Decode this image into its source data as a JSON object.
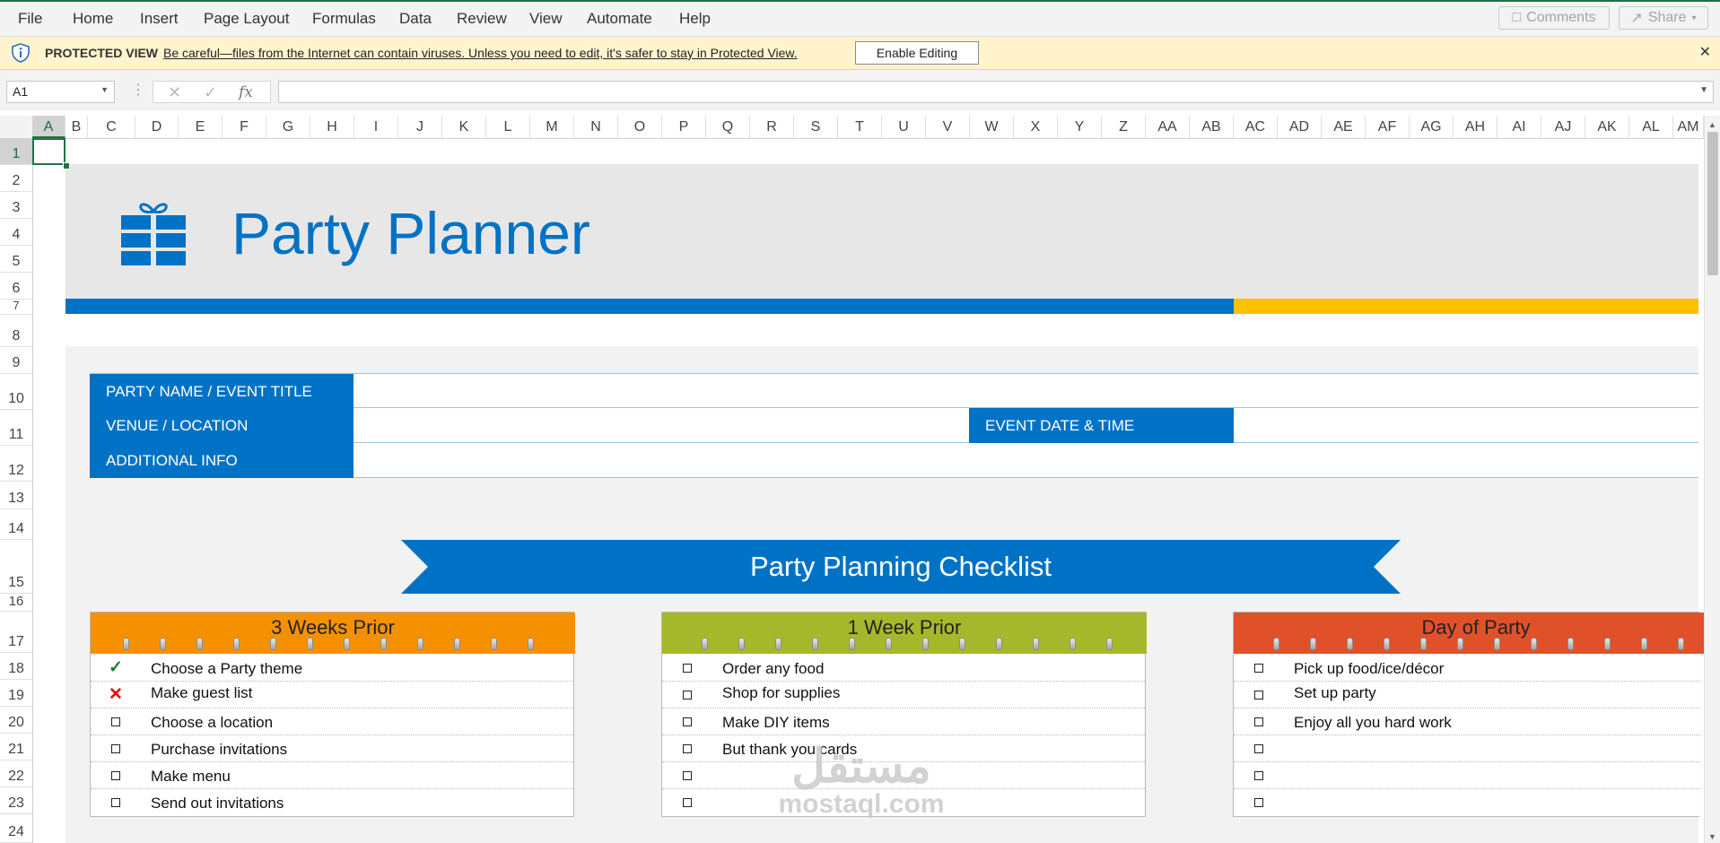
{
  "menu": {
    "items": [
      "File",
      "Home",
      "Insert",
      "Page Layout",
      "Formulas",
      "Data",
      "Review",
      "View",
      "Automate",
      "Help"
    ],
    "comments_label": "Comments",
    "share_label": "Share"
  },
  "protected_view": {
    "title": "PROTECTED VIEW",
    "message": "Be careful—files from the Internet can contain viruses. Unless you need to edit, it's safer to stay in Protected View.",
    "enable_label": "Enable Editing"
  },
  "formula_bar": {
    "name_box": "A1",
    "formula": ""
  },
  "columns": [
    "A",
    "B",
    "C",
    "D",
    "E",
    "F",
    "G",
    "H",
    "I",
    "J",
    "K",
    "L",
    "M",
    "N",
    "O",
    "P",
    "Q",
    "R",
    "S",
    "T",
    "U",
    "V",
    "W",
    "X",
    "Y",
    "Z",
    "AA",
    "AB",
    "AC",
    "AD",
    "AE",
    "AF",
    "AG",
    "AH",
    "AI",
    "AJ",
    "AK",
    "AL",
    "AM"
  ],
  "rows": [
    "1",
    "2",
    "3",
    "4",
    "5",
    "6",
    "7",
    "8",
    "9",
    "10",
    "11",
    "12",
    "13",
    "14",
    "15",
    "16",
    "17",
    "18",
    "19",
    "20",
    "21",
    "22",
    "23",
    "24"
  ],
  "sheet": {
    "title": "Party Planner",
    "info": {
      "party_name_label": "PARTY NAME / EVENT TITLE",
      "venue_label": "VENUE / LOCATION",
      "date_label": "EVENT DATE & TIME",
      "additional_label": "ADDITIONAL INFO"
    },
    "checklist_title": "Party Planning Checklist",
    "cards": [
      {
        "title": "3 Weeks Prior",
        "color": "#f59100",
        "items": [
          {
            "status": "check",
            "text": "Choose a Party theme"
          },
          {
            "status": "cross",
            "text": "Make guest list"
          },
          {
            "status": "box",
            "text": "Choose a location"
          },
          {
            "status": "box",
            "text": "Purchase invitations"
          },
          {
            "status": "box",
            "text": "Make menu"
          },
          {
            "status": "box",
            "text": "Send out invitations"
          }
        ]
      },
      {
        "title": "1 Week Prior",
        "color": "#a5b82b",
        "items": [
          {
            "status": "box",
            "text": "Order any food"
          },
          {
            "status": "box",
            "text": "Shop for supplies"
          },
          {
            "status": "box",
            "text": "Make DIY items"
          },
          {
            "status": "box",
            "text": "But thank you cards"
          },
          {
            "status": "box",
            "text": ""
          },
          {
            "status": "box",
            "text": ""
          }
        ]
      },
      {
        "title": "Day of Party",
        "color": "#e0512a",
        "items": [
          {
            "status": "box",
            "text": "Pick up food/ice/décor"
          },
          {
            "status": "box",
            "text": "Set up party"
          },
          {
            "status": "box",
            "text": "Enjoy all you hard work"
          },
          {
            "status": "box",
            "text": ""
          },
          {
            "status": "box",
            "text": ""
          },
          {
            "status": "box",
            "text": ""
          }
        ]
      }
    ]
  },
  "watermark": {
    "arabic": "مستقل",
    "latin": "mostaql.com"
  },
  "colors": {
    "accent_blue": "#0072c6",
    "accent_yellow": "#ffc000",
    "excel_green": "#217346"
  }
}
